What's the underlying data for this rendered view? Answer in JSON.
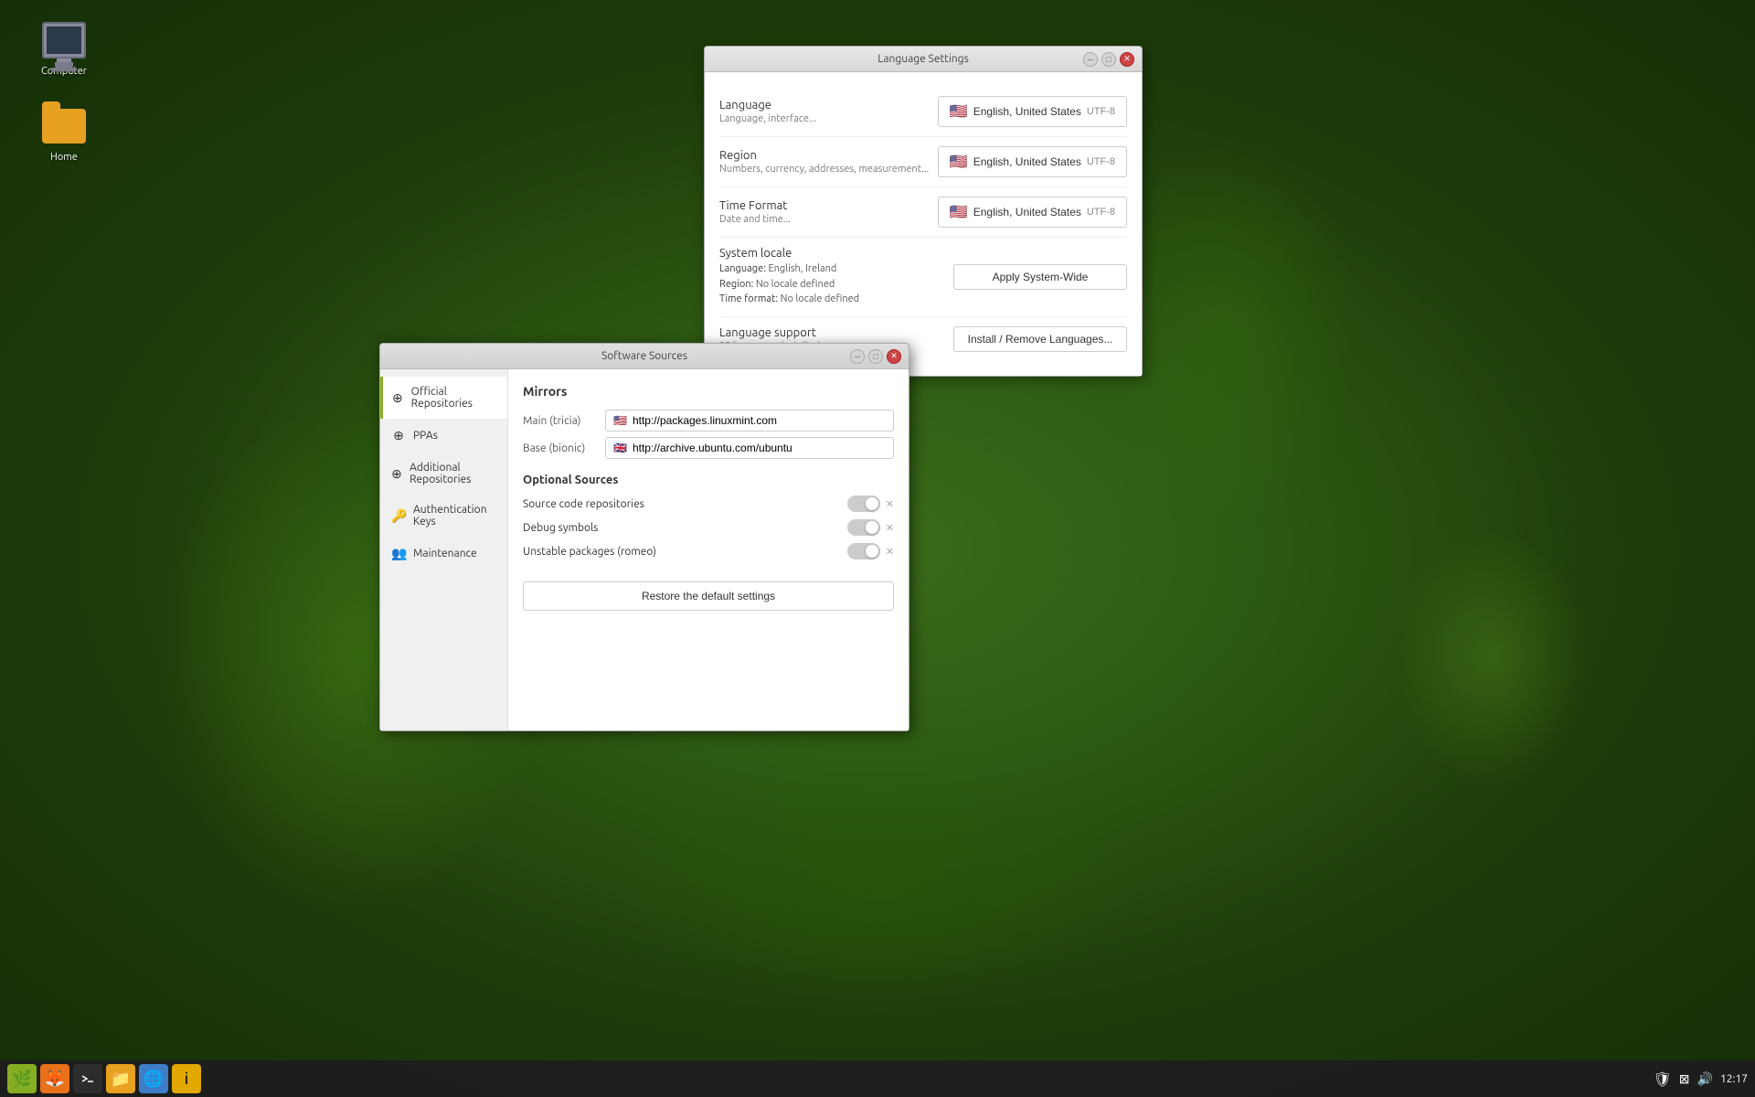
{
  "desktop": {
    "icons": [
      {
        "id": "computer",
        "label": "Computer",
        "type": "monitor"
      },
      {
        "id": "home",
        "label": "Home",
        "type": "folder"
      }
    ]
  },
  "taskbar": {
    "apps": [
      {
        "id": "mint",
        "icon": "🌿",
        "type": "mint"
      },
      {
        "id": "files",
        "icon": "🦊",
        "type": "files"
      },
      {
        "id": "terminal",
        "icon": "⬛",
        "type": "terminal"
      },
      {
        "id": "folder",
        "icon": "📁",
        "type": "folder"
      },
      {
        "id": "globe",
        "icon": "🌐",
        "type": "globe"
      },
      {
        "id": "info",
        "icon": "ℹ",
        "type": "info"
      }
    ],
    "right": {
      "time": "12:17",
      "shield_icon": "🛡",
      "network_icon": "📶",
      "volume_icon": "🔊"
    }
  },
  "language_window": {
    "title": "Language Settings",
    "rows": [
      {
        "id": "language",
        "label": "Language",
        "sublabel": "Language, interface...",
        "btn_flag": "🇺🇸",
        "btn_text": "English, United States",
        "btn_suffix": "UTF-8"
      },
      {
        "id": "region",
        "label": "Region",
        "sublabel": "Numbers, currency, addresses, measurement...",
        "btn_flag": "🇺🇸",
        "btn_text": "English, United States",
        "btn_suffix": "UTF-8"
      },
      {
        "id": "time_format",
        "label": "Time Format",
        "sublabel": "Date and time...",
        "btn_flag": "🇺🇸",
        "btn_text": "English, United States",
        "btn_suffix": "UTF-8"
      },
      {
        "id": "system_locale",
        "label": "System locale",
        "sublabel_lines": [
          "Language: English, Ireland",
          "Region: No locale defined",
          "Time format: No locale defined"
        ],
        "btn_text": "Apply System-Wide",
        "btn_type": "action"
      },
      {
        "id": "language_support",
        "label": "Language support",
        "sublabel": "23 languages installed",
        "btn_text": "Install / Remove Languages...",
        "btn_type": "action"
      }
    ]
  },
  "software_window": {
    "title": "Software Sources",
    "sidebar": {
      "items": [
        {
          "id": "official",
          "icon": "⊕",
          "label": "Official Repositories",
          "active": true
        },
        {
          "id": "ppas",
          "icon": "⊕",
          "label": "PPAs",
          "active": false
        },
        {
          "id": "additional",
          "icon": "⊕",
          "label": "Additional Repositories",
          "active": false
        },
        {
          "id": "auth_keys",
          "icon": "🔑",
          "label": "Authentication Keys",
          "active": false
        },
        {
          "id": "maintenance",
          "icon": "👥",
          "label": "Maintenance",
          "active": false
        }
      ]
    },
    "main": {
      "mirrors_title": "Mirrors",
      "mirrors": [
        {
          "id": "main",
          "label": "Main (tricia)",
          "flag": "🇺🇸",
          "url": "http://packages.linuxmint.com"
        },
        {
          "id": "base",
          "label": "Base (bionic)",
          "flag": "🇬🇧",
          "url": "http://archive.ubuntu.com/ubuntu"
        }
      ],
      "optional_title": "Optional Sources",
      "toggles": [
        {
          "id": "source_code",
          "label": "Source code repositories",
          "on": false
        },
        {
          "id": "debug_symbols",
          "label": "Debug symbols",
          "on": false
        },
        {
          "id": "unstable",
          "label": "Unstable packages (romeo)",
          "on": false
        }
      ],
      "restore_btn": "Restore the default settings"
    }
  }
}
